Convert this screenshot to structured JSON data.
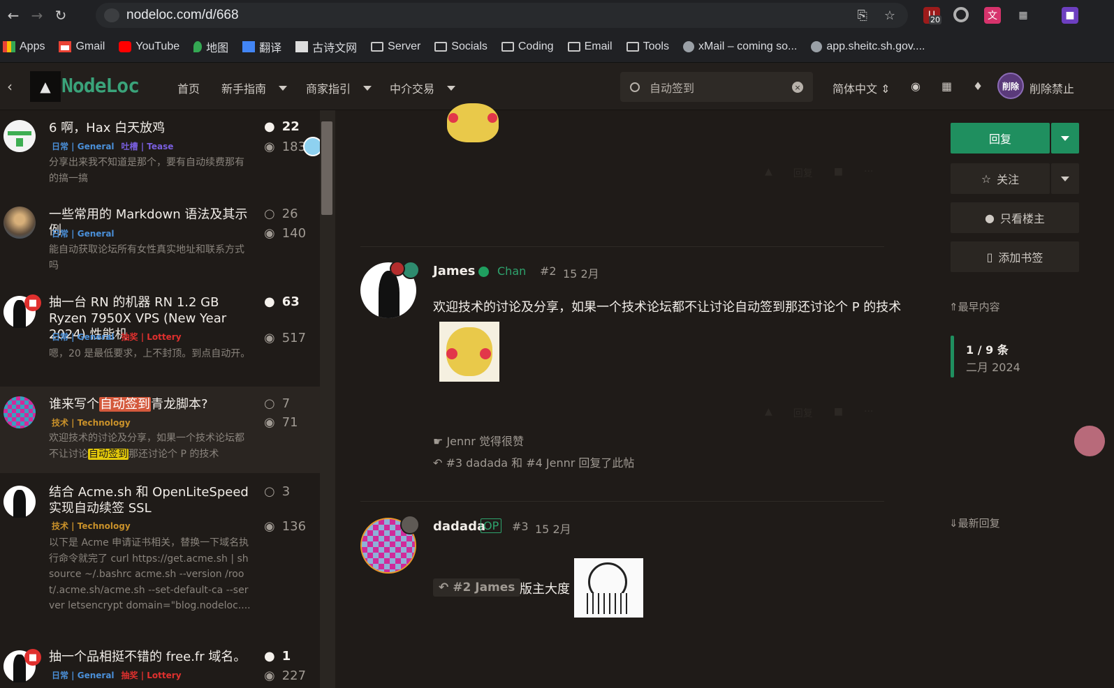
{
  "browser": {
    "url": "nodeloc.com/d/668",
    "ext_badge": "20",
    "bookmarks": [
      "Apps",
      "Gmail",
      "YouTube",
      "地图",
      "翻译",
      "古诗文网",
      "Server",
      "Socials",
      "Coding",
      "Email",
      "Tools",
      "xMail – coming so...",
      "app.sheitc.sh.gov...."
    ]
  },
  "header": {
    "logo": "NodeLoc",
    "nav": [
      "首页",
      "新手指南",
      "商家指引",
      "中介交易"
    ],
    "search_value": "自动签到",
    "lang": "简体中文",
    "avatar_text": "削除",
    "username": "削除禁止"
  },
  "topics": [
    {
      "title": "6 啊，Hax 白天放鸡",
      "tags": [
        "日常 | General",
        "吐槽 | Tease"
      ],
      "excerpt": "分享出来我不知道是那个，要有自动续费那有的搞一搞",
      "replies": "22",
      "views": "183"
    },
    {
      "title": "一些常用的 Markdown 语法及其示例",
      "tags": [
        "日常 | General"
      ],
      "excerpt": "能自动获取论坛所有女性真实地址和联系方式吗",
      "replies": "26",
      "views": "140"
    },
    {
      "title": "抽一台 RN 的机器 RN 1.2 GB Ryzen 7950X VPS (New Year 2024) 性能机",
      "tags": [
        "日常 | General",
        "抽奖 | Lottery"
      ],
      "excerpt": "嗯，20 是最低要求，上不封顶。到点自动开。",
      "replies": "63",
      "views": "517"
    },
    {
      "title_pre": "谁来写个",
      "title_hl": "自动签到",
      "title_post": "青龙脚本?",
      "tags": [
        "技术 | Technology"
      ],
      "excerpt_pre": "欢迎技术的讨论及分享，如果一个技术论坛都不让讨论",
      "excerpt_hl": "自动签到",
      "excerpt_post": "那还讨论个 P 的技术",
      "replies": "7",
      "views": "71"
    },
    {
      "title": "结合 Acme.sh 和 OpenLiteSpeed 实现自动续签 SSL",
      "tags": [
        "技术 | Technology"
      ],
      "excerpt": "以下是 Acme 申请证书相关，替换一下域名执行命令就完了 curl https://get.acme.sh | sh source ~/.bashrc acme.sh --version /root/.acme.sh/acme.sh --set-default-ca --server letsencrypt domain=\"blog.nodeloc....",
      "replies": "3",
      "views": "136"
    },
    {
      "title": "抽一个品相挺不错的 free.fr 域名。",
      "tags": [
        "日常 | General",
        "抽奖 | Lottery"
      ],
      "replies": "1",
      "views": "227"
    }
  ],
  "posts": {
    "p2": {
      "author": "James",
      "group": "Chan",
      "num": "#2",
      "date": "15 2月",
      "body": "欢迎技术的讨论及分享，如果一个技术论坛都不让讨论自动签到那还讨论个 P 的技术",
      "likes": "Jennr 觉得很赞",
      "replied": "#3 dadada 和 #4 Jennr 回复了此帖"
    },
    "p3": {
      "author": "dadada",
      "op": "OP",
      "num": "#3",
      "date": "15 2月",
      "quote": "#2 James",
      "body": "版主大度"
    },
    "faded_actions": [
      "回复"
    ]
  },
  "sidebar": {
    "reply": "回复",
    "follow": "关注",
    "only_op": "只看楼主",
    "bookmark": "添加书签",
    "earliest": "最早内容",
    "position": "1 / 9 条",
    "month": "二月 2024",
    "latest": "最新回复"
  }
}
